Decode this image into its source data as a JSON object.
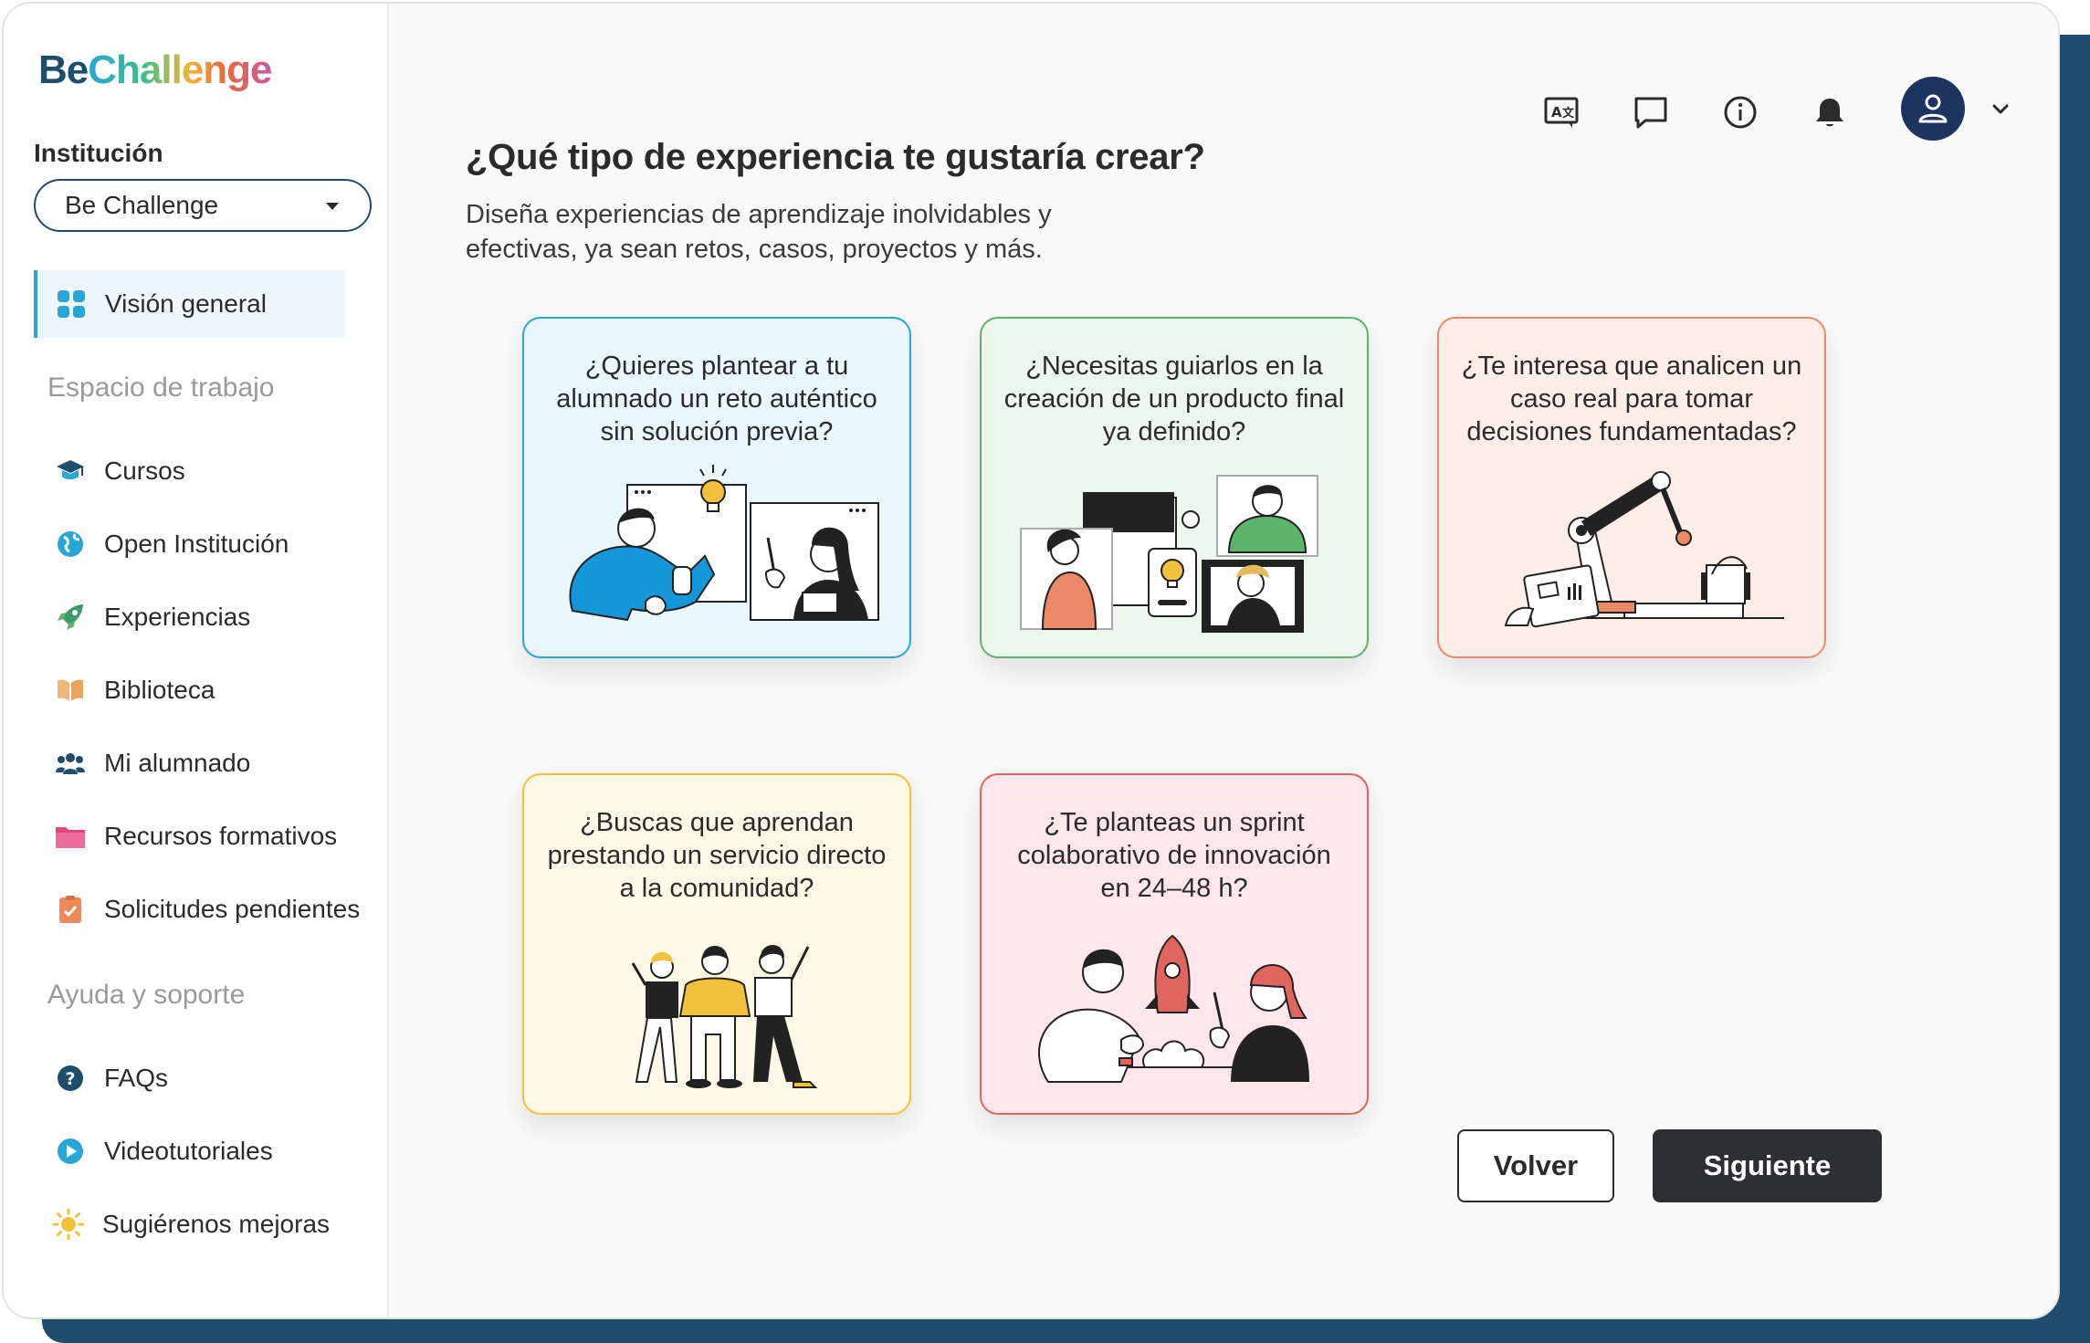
{
  "brand": {
    "logo_be": "Be",
    "logo_challenge": "Challenge"
  },
  "institution": {
    "label": "Institución",
    "selected": "Be Challenge"
  },
  "nav": {
    "overview": "Visión general",
    "workspace_title": "Espacio de trabajo",
    "workspace": [
      "Cursos",
      "Open Institución",
      "Experiencias",
      "Biblioteca",
      "Mi alumnado",
      "Recursos formativos",
      "Solicitudes pendientes"
    ],
    "help_title": "Ayuda y soporte",
    "help": [
      "FAQs",
      "Videotutoriales",
      "Sugiérenos mejoras"
    ]
  },
  "topbar_icons": [
    "translate-icon",
    "chat-icon",
    "info-icon",
    "bell-icon",
    "user-icon",
    "chevron-down-icon"
  ],
  "main": {
    "title": "¿Qué tipo de experiencia te gustaría crear?",
    "subtitle": "Diseña experiencias de aprendizaje inolvidables y efectivas, ya sean retos, casos, proyectos y más."
  },
  "cards": [
    {
      "question": "¿Quieres plantear a tu alumnado un reto auténtico sin solución previa?",
      "bg": "#eaf7fd",
      "border": "#2aa6d6"
    },
    {
      "question": "¿Necesitas guiarlos en la creación de un producto final ya definido?",
      "bg": "#ecf8ee",
      "border": "#5cb46a"
    },
    {
      "question": "¿Te interesa que analicen un caso real para tomar decisiones fundamentadas?",
      "bg": "#fdeee7",
      "border": "#ec8a68"
    },
    {
      "question": "¿Buscas que aprendan prestando un servicio directo a la comunidad?",
      "bg": "#fef8e6",
      "border": "#f2c23c"
    },
    {
      "question": "¿Te planteas un sprint colaborativo de innovación en 24–48 h?",
      "bg": "#fde6ec",
      "border": "#e0655e"
    }
  ],
  "buttons": {
    "back": "Volver",
    "next": "Siguiente"
  },
  "colors": {
    "brand_navy": "#1f4d6e",
    "accent_blue": "#2aa6d6",
    "dark_button": "#2d2f33"
  }
}
